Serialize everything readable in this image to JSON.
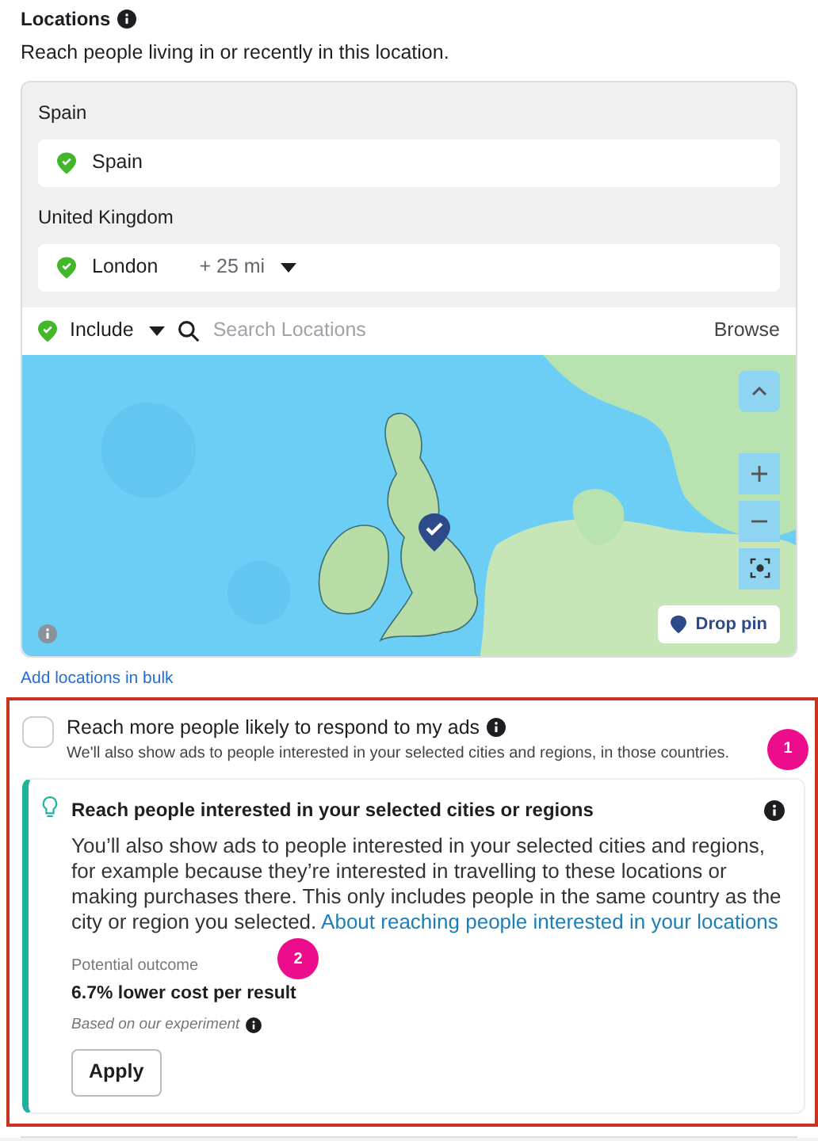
{
  "section": {
    "title": "Locations",
    "subtitle": "Reach people living in or recently in this location."
  },
  "location_groups": [
    {
      "country": "Spain",
      "items": [
        {
          "name": "Spain"
        }
      ]
    },
    {
      "country": "United Kingdom",
      "items": [
        {
          "name": "London",
          "radius": "+ 25 mi"
        }
      ]
    }
  ],
  "search_bar": {
    "mode": "Include",
    "placeholder": "Search Locations",
    "browse": "Browse"
  },
  "map": {
    "kind": "picture",
    "drop_pin": "Drop pin"
  },
  "bulk_link": "Add locations in bulk",
  "option": {
    "label": "Reach more people likely to respond to my ads",
    "description": "We'll also show ads to people interested in your selected cities and regions, in those countries.",
    "checked": false
  },
  "suggestion": {
    "title": "Reach people interested in your selected cities or regions",
    "body": "You’ll also show ads to people interested in your selected cities and regions, for example because they’re interested in travelling to these locations or making purchases there. This only includes people in the same country as the city or region you selected.",
    "link": "About reaching people interested in your locations",
    "outcome_label": "Potential outcome",
    "outcome_value": "6.7% lower cost per result",
    "note": "Based on our experiment",
    "button": "Apply"
  },
  "annotations": [
    {
      "number": "1"
    },
    {
      "number": "2"
    }
  ]
}
